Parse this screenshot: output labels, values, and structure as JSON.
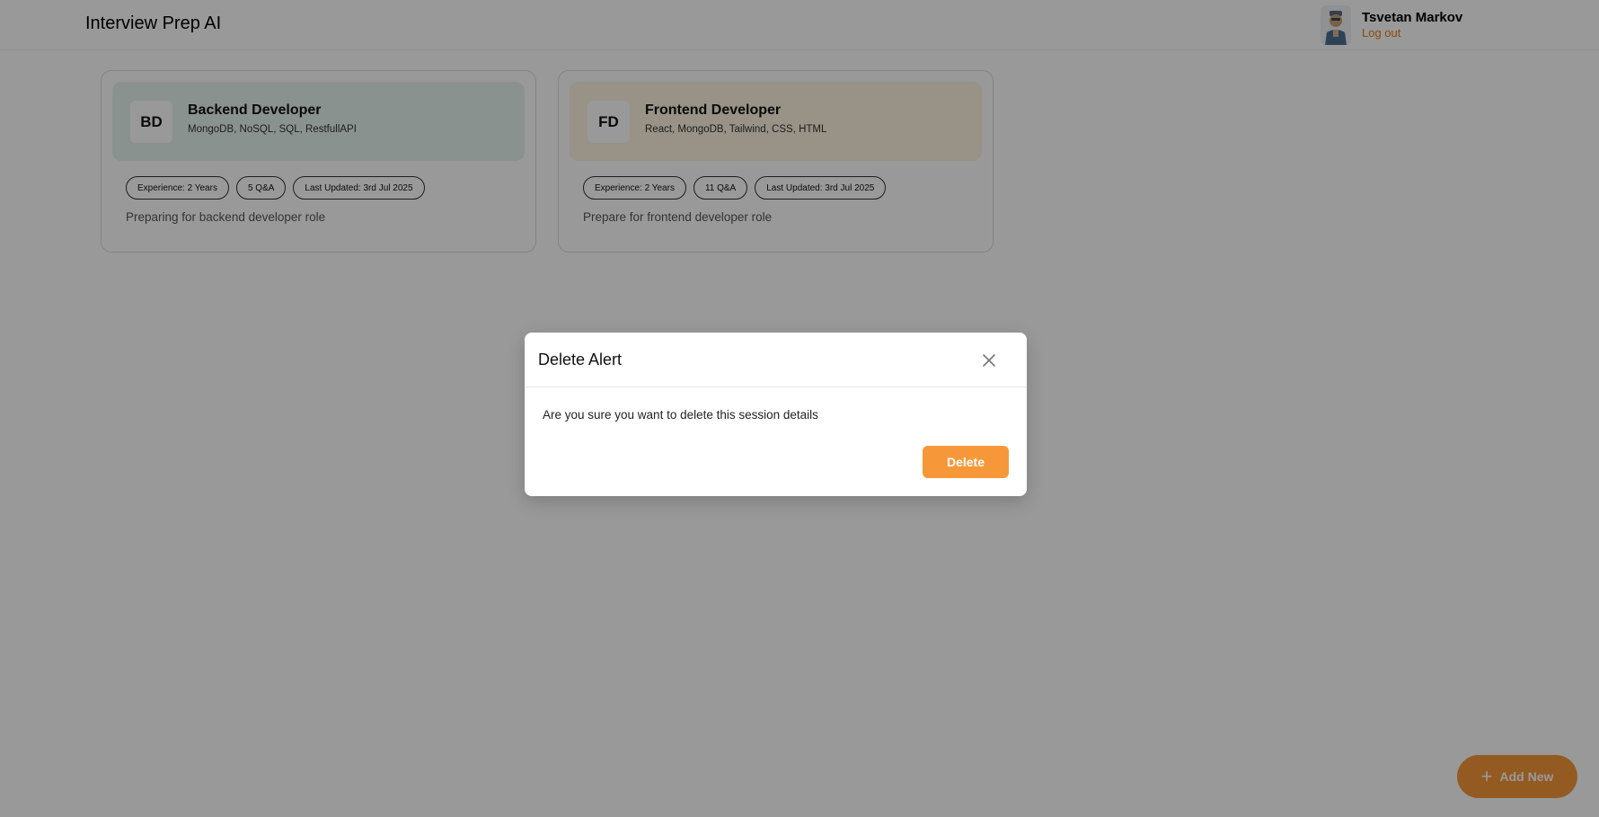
{
  "app": {
    "title": "Interview Prep AI"
  },
  "user": {
    "name": "Tsvetan Markov",
    "logout_label": "Log out",
    "avatar_icon": "user-avatar-icon"
  },
  "sessions": [
    {
      "initials": "BD",
      "role": "Backend Developer",
      "topics": "MongoDB, NoSQL, SQL, RestfullAPI",
      "experience": "Experience: 2 Years",
      "qa_count": "5 Q&A",
      "last_updated": "Last Updated: 3rd Jul 2025",
      "description": "Preparing for backend developer role",
      "accent_color": "#e6f4ef"
    },
    {
      "initials": "FD",
      "role": "Frontend Developer",
      "topics": "React, MongoDB, Tailwind, CSS, HTML",
      "experience": "Experience: 2 Years",
      "qa_count": "11 Q&A",
      "last_updated": "Last Updated: 3rd Jul 2025",
      "description": "Prepare for frontend developer role",
      "accent_color": "#fdf3e1"
    }
  ],
  "add_new": {
    "label": "Add New",
    "icon": "plus-icon"
  },
  "modal": {
    "title": "Delete Alert",
    "message": "Are you sure you want to delete this session details",
    "delete_label": "Delete",
    "close_icon": "close-icon"
  },
  "colors": {
    "accent": "#f6983a",
    "logout": "#e67d10",
    "overlay": "rgba(0,0,0,0.40)"
  }
}
